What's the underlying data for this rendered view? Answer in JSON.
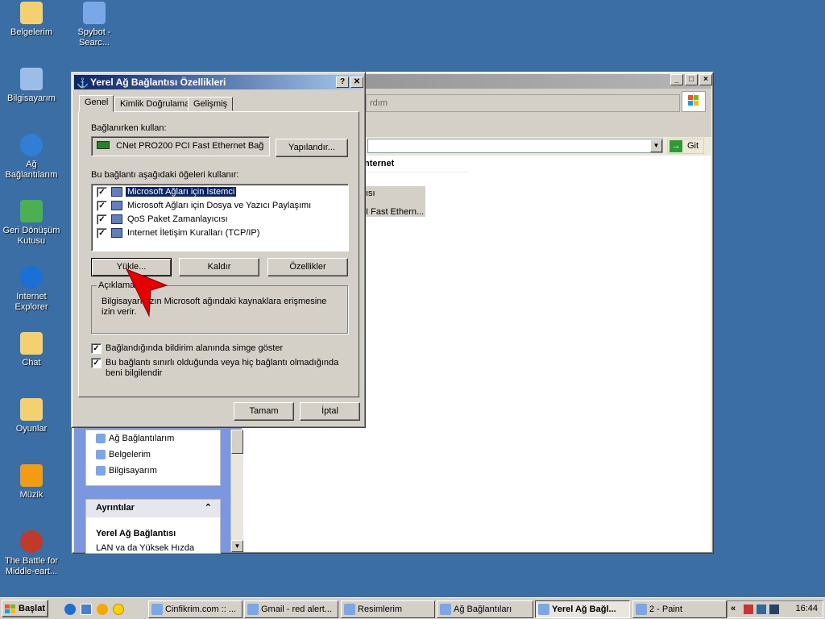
{
  "desktop_icons": [
    {
      "label": "Belgelerim"
    },
    {
      "label": "Spybot -\nSearc..."
    },
    {
      "label": "Bilgisayarım"
    },
    {
      "label": "Ağ\nBağlantılarım"
    },
    {
      "label": "Geri Dönüşüm\nKutusu"
    },
    {
      "label": "Internet\nExplorer"
    },
    {
      "label": "Chat"
    },
    {
      "label": "Oyunlar"
    },
    {
      "label": "Müzik"
    },
    {
      "label": "The Battle for\nMiddle-eart..."
    }
  ],
  "bg_window": {
    "address_hint": "rdım",
    "go_label": "Git",
    "content_heading": "nternet",
    "content_item_a": "ısı",
    "content_item_b": "I Fast Ethern...",
    "left_links": [
      "Ağ Bağlantılarım",
      "Belgelerim",
      "Bilgisayarım"
    ],
    "details_title": "Ayrıntılar",
    "details_name": "Yerel Ağ Bağlantısı",
    "details_desc": "LAN va da Yüksek Hızda"
  },
  "dialog": {
    "title": "Yerel Ağ Bağlantısı Özellikleri",
    "help_label": "?",
    "close_label": "✕",
    "tabs": [
      "Genel",
      "Kimlik Doğrulama",
      "Gelişmiş"
    ],
    "connect_using_label": "Bağlanırken kullan:",
    "adapter_name": "CNet PRO200 PCI Fast Ethernet Bağ",
    "configure_button": "Yapılandır...",
    "items_label": "Bu bağlantı aşağıdaki öğeleri kullanır:",
    "items": [
      {
        "label": "Microsoft Ağları için İstemci",
        "checked": true,
        "selected": true
      },
      {
        "label": "Microsoft Ağları için Dosya ve Yazıcı Paylaşımı",
        "checked": true,
        "selected": false
      },
      {
        "label": "QoS Paket Zamanlayıcısı",
        "checked": true,
        "selected": false
      },
      {
        "label": "Internet İletişim Kuralları (TCP/IP)",
        "checked": true,
        "selected": false
      }
    ],
    "install_button": "Yükle...",
    "uninstall_button": "Kaldır",
    "properties_button": "Özellikler",
    "description_title": "Açıklama",
    "description_text": "Bilgisayarınızın Microsoft ağındaki kaynaklara erişmesine izin verir.",
    "show_icon_label": "Bağlandığında bildirim alanında simge göster",
    "notify_label": "Bu bağlantı sınırlı olduğunda veya hiç bağlantı olmadığında beni bilgilendir",
    "ok_button": "Tamam",
    "cancel_button": "İptal"
  },
  "taskbar": {
    "start_label": "Başlat",
    "buttons": [
      "Cinfikrim.com :: ...",
      "Gmail - red alert...",
      "Resimlerim",
      "Ağ Bağlantıları",
      "Yerel Ağ Bağl...",
      "2 - Paint"
    ],
    "active_index": 4,
    "tray_expand": "«",
    "clock": "16:44"
  }
}
